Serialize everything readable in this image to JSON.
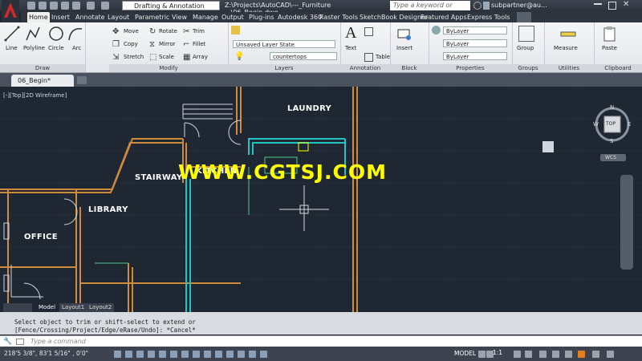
{
  "window": {
    "workspace": "Drafting & Annotation",
    "title": "Z:\\Projects\\AutoCAD\\---_Furniture ...\\06_Begin.dwg",
    "search_placeholder": "Type a keyword or phrase",
    "user": "subpartner@au..."
  },
  "tabs": [
    "Home",
    "Insert",
    "Annotate",
    "Layout",
    "Parametric",
    "View",
    "Manage",
    "Output",
    "Plug-ins",
    "Autodesk 360",
    "Raster Tools",
    "SketchBook Designer",
    "Featured Apps",
    "Express Tools"
  ],
  "active_tab": "Home",
  "ribbon": {
    "draw": {
      "title": "Draw",
      "tools": [
        "Line",
        "Polyline",
        "Circle",
        "Arc"
      ]
    },
    "modify": {
      "title": "Modify",
      "tools": [
        "Move",
        "Rotate",
        "Trim",
        "Copy",
        "Mirror",
        "Fillet",
        "Stretch",
        "Scale",
        "Array"
      ]
    },
    "layers": {
      "title": "Layers",
      "layer_state": "Unsaved Layer State",
      "current_layer": "countertops"
    },
    "annotation": {
      "title": "Annotation",
      "tools": [
        "Text",
        "Table"
      ]
    },
    "block": {
      "title": "Block",
      "tools": [
        "Insert"
      ]
    },
    "properties": {
      "title": "Properties",
      "values": [
        "ByLayer",
        "ByLayer",
        "ByLayer"
      ]
    },
    "groups": {
      "title": "Groups",
      "tools": [
        "Group"
      ]
    },
    "utilities": {
      "title": "Utilities",
      "tools": [
        "Measure"
      ]
    },
    "clipboard": {
      "title": "Clipboard",
      "tools": [
        "Paste"
      ]
    }
  },
  "file_tab": "06_Begin*",
  "drawing": {
    "viewport_label": "[-][Top][2D Wireframe]",
    "rooms": [
      "LAUNDRY",
      "STAIRWAY",
      "KITCHEN",
      "LIBRARY",
      "OFFICE"
    ],
    "watermark": "WWW.CGTSJ.COM",
    "viewcube": {
      "top": "TOP",
      "n": "N",
      "s": "S",
      "e": "E",
      "w": "W",
      "wcs": "WCS"
    }
  },
  "layout_tabs": [
    "Model",
    "Layout1",
    "Layout2"
  ],
  "command": {
    "history": [
      "Select object to trim or shift-select to extend or",
      "[Fence/Crossing/Project/Edge/eRase/Undo]: *Cancel*"
    ],
    "placeholder": "Type a command"
  },
  "status": {
    "coordinates": "218'5 3/8\", 83'1 5/16\" , 0'0\"",
    "model": "MODEL",
    "scale": "1:1"
  },
  "colors": {
    "walls": "#d08a3c",
    "cabinets": "#20c4c4",
    "background": "#1f2733",
    "watermark": "#ffff00"
  }
}
